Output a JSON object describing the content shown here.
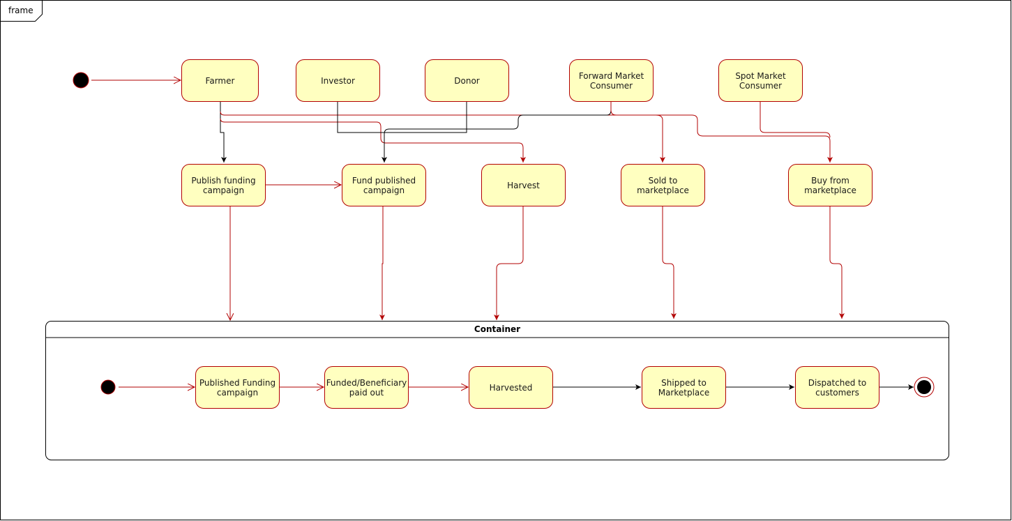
{
  "frame": {
    "label": "frame"
  },
  "colors": {
    "state_fill": "#ffffc0",
    "state_stroke": "#b20000",
    "red_edge": "#b20000",
    "black_edge": "#000000"
  },
  "actors": [
    {
      "id": "farmer",
      "label": "Farmer"
    },
    {
      "id": "investor",
      "label": "Investor"
    },
    {
      "id": "donor",
      "label": "Donor"
    },
    {
      "id": "forward",
      "label": "Forward Market\nConsumer"
    },
    {
      "id": "spot",
      "label": "Spot Market\nConsumer"
    }
  ],
  "actions": [
    {
      "id": "publish",
      "label": "Publish funding\ncampaign"
    },
    {
      "id": "fund",
      "label": "Fund published\ncampaign"
    },
    {
      "id": "harvest",
      "label": "Harvest"
    },
    {
      "id": "sold",
      "label": "Sold to\nmarketplace"
    },
    {
      "id": "buy",
      "label": "Buy from\nmarketplace"
    }
  ],
  "container": {
    "title": "Container",
    "states": [
      {
        "id": "s1",
        "label": "Published Funding\ncampaign"
      },
      {
        "id": "s2",
        "label": "Funded/Beneficiary\npaid out"
      },
      {
        "id": "s3",
        "label": "Harvested"
      },
      {
        "id": "s4",
        "label": "Shipped to\nMarketplace"
      },
      {
        "id": "s5",
        "label": "Dispatched to\ncustomers"
      }
    ]
  },
  "edges": [
    {
      "from": "initial",
      "to": "farmer",
      "color": "red"
    },
    {
      "from": "farmer",
      "to": "publish",
      "color": "black"
    },
    {
      "from": "farmer",
      "to": "harvest",
      "color": "red"
    },
    {
      "from": "farmer",
      "to": "sold",
      "color": "red"
    },
    {
      "from": "investor",
      "to": "fund",
      "color": "black"
    },
    {
      "from": "donor",
      "to": "fund",
      "color": "black"
    },
    {
      "from": "forward",
      "to": "fund",
      "color": "black"
    },
    {
      "from": "forward",
      "to": "sold",
      "color": "red"
    },
    {
      "from": "forward",
      "to": "buy",
      "color": "red"
    },
    {
      "from": "spot",
      "to": "buy",
      "color": "red"
    },
    {
      "from": "publish",
      "to": "fund",
      "color": "red"
    },
    {
      "from": "publish",
      "to": "container",
      "color": "red"
    },
    {
      "from": "fund",
      "to": "container",
      "color": "red"
    },
    {
      "from": "harvest",
      "to": "container",
      "color": "red"
    },
    {
      "from": "sold",
      "to": "container",
      "color": "red"
    },
    {
      "from": "buy",
      "to": "container",
      "color": "red"
    },
    {
      "from": "inner-initial",
      "to": "s1",
      "color": "red"
    },
    {
      "from": "s1",
      "to": "s2",
      "color": "red"
    },
    {
      "from": "s2",
      "to": "s3",
      "color": "red"
    },
    {
      "from": "s3",
      "to": "s4",
      "color": "black"
    },
    {
      "from": "s4",
      "to": "s5",
      "color": "black"
    },
    {
      "from": "s5",
      "to": "final",
      "color": "black"
    }
  ]
}
